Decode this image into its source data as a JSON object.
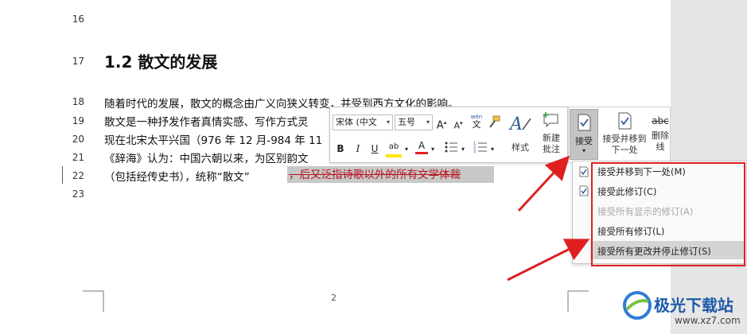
{
  "document": {
    "line_numbers": [
      "16",
      "17",
      "18",
      "19",
      "20",
      "21",
      "22",
      "23"
    ],
    "heading": "1.2 散文的发展",
    "lines": [
      "随着时代的发展，散文的概念由广义向狭义转变，并受到西方文化的影响。",
      "散文是一种抒发作者真情实感、写作方式灵",
      "现在北宋太平兴国（976 年 12 月-984 年 11",
      "《辞海》认为：中国六朝以来，为区别韵文",
      "（包括经传史书），统称“散文”"
    ],
    "deleted_text": "，后又泛指诗歌以外的所有文学体裁",
    "page_number": "2"
  },
  "mini_toolbar": {
    "font_name": "宋体 (中文",
    "font_size": "五号",
    "grow_font": "A",
    "shrink_font": "A",
    "phonetic": "wén",
    "phonetic_char": "文",
    "bold": "B",
    "italic": "I",
    "highlight": "ab",
    "font_color": "A",
    "styles_label": "样式",
    "new_comment_label_1": "新建",
    "new_comment_label_2": "批注"
  },
  "ribbon": {
    "accept_label": "接受",
    "accept_move_next_1": "接受并移到",
    "accept_move_next_2": "下一处",
    "delete_line_1": "删除",
    "delete_line_2": "线",
    "strike_glyph": "abc"
  },
  "accept_menu": {
    "items": [
      {
        "label": "接受并移到下一处(M)",
        "enabled": true
      },
      {
        "label": "接受此修订(C)",
        "enabled": true
      },
      {
        "label": "接受所有显示的修订(A)",
        "enabled": false
      },
      {
        "label": "接受所有修订(L)",
        "enabled": true
      },
      {
        "label": "接受所有更改并停止修订(S)",
        "enabled": true
      }
    ]
  },
  "watermark": {
    "text": "极光下载站",
    "url": "www.xz7.com"
  },
  "colors": {
    "accent_red": "#e02020",
    "deleted_text": "#b4161f",
    "icon_blue": "#2e5c97"
  }
}
